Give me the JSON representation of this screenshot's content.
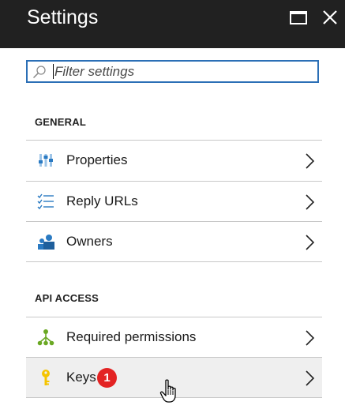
{
  "header": {
    "title": "Settings",
    "maximize_icon": "maximize-icon",
    "close_icon": "close-icon"
  },
  "search": {
    "placeholder": "Filter settings",
    "value": "",
    "icon": "search-icon"
  },
  "sections": {
    "general": {
      "title": "GENERAL",
      "items": [
        {
          "label": "Properties",
          "icon": "properties-icon"
        },
        {
          "label": "Reply URLs",
          "icon": "reply-urls-icon"
        },
        {
          "label": "Owners",
          "icon": "owners-icon"
        }
      ]
    },
    "api_access": {
      "title": "API ACCESS",
      "items": [
        {
          "label": "Required permissions",
          "icon": "permissions-icon"
        },
        {
          "label": "Keys",
          "icon": "key-icon",
          "badge": "1"
        }
      ]
    }
  },
  "colors": {
    "header_bg": "#212121",
    "search_border": "#2b6fb6",
    "badge": "#e32323",
    "hover_bg": "#efefef",
    "permissions_icon": "#6aa823",
    "key_icon": "#f5c400",
    "icon_blue": "#2a7ac2"
  }
}
